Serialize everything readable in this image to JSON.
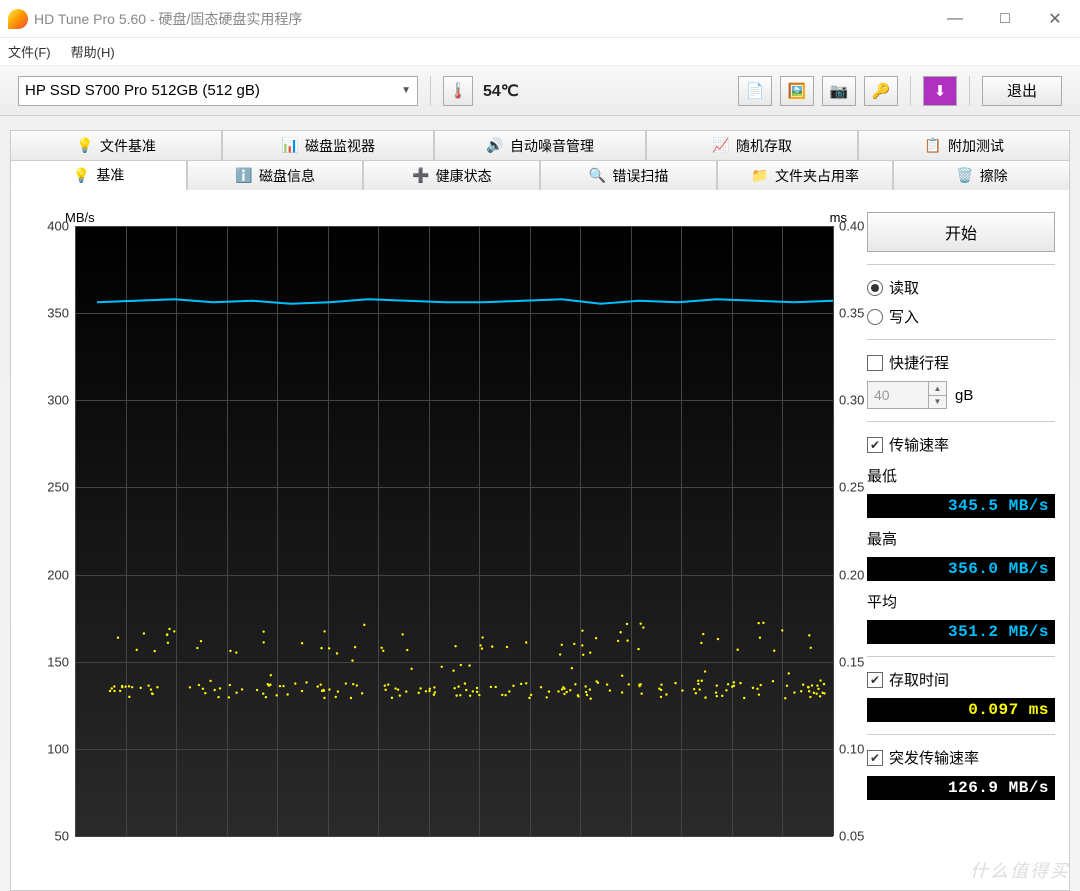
{
  "titlebar": {
    "title": "HD Tune Pro 5.60 - 硬盘/固态硬盘实用程序"
  },
  "menubar": {
    "file": "文件(F)",
    "help": "帮助(H)"
  },
  "toolbar": {
    "device": "HP SSD S700 Pro 512GB (512 gB)",
    "temperature": "54℃",
    "exit": "退出"
  },
  "tabs_top": [
    {
      "icon": "💡",
      "label": "文件基准"
    },
    {
      "icon": "📊",
      "label": "磁盘监视器"
    },
    {
      "icon": "🔊",
      "label": "自动噪音管理"
    },
    {
      "icon": "📈",
      "label": "随机存取"
    },
    {
      "icon": "📋",
      "label": "附加测试"
    }
  ],
  "tabs_bottom": [
    {
      "icon": "💡",
      "label": "基准",
      "active": true
    },
    {
      "icon": "ℹ️",
      "label": "磁盘信息"
    },
    {
      "icon": "➕",
      "label": "健康状态"
    },
    {
      "icon": "🔍",
      "label": "错误扫描"
    },
    {
      "icon": "📁",
      "label": "文件夹占用率"
    },
    {
      "icon": "🗑️",
      "label": "擦除"
    }
  ],
  "chart": {
    "left_unit": "MB/s",
    "right_unit": "ms",
    "left_ticks": [
      400,
      350,
      300,
      250,
      200,
      150,
      100,
      50
    ],
    "right_ticks": [
      "0.40",
      "0.35",
      "0.30",
      "0.25",
      "0.20",
      "0.15",
      "0.10",
      "0.05"
    ]
  },
  "side": {
    "start": "开始",
    "read": "读取",
    "write": "写入",
    "quick": "快捷行程",
    "quick_val": "40",
    "quick_unit": "gB",
    "transfer": "传输速率",
    "min_label": "最低",
    "min_value": "345.5 MB/s",
    "max_label": "最高",
    "max_value": "356.0 MB/s",
    "avg_label": "平均",
    "avg_value": "351.2 MB/s",
    "access_label": "存取时间",
    "access_value": "0.097 ms",
    "burst_label": "突发传输速率",
    "burst_value": "126.9 MB/s"
  },
  "chart_data": {
    "type": "line",
    "title": "",
    "xlabel": "",
    "y_left_label": "MB/s",
    "y_left_lim": [
      0,
      400
    ],
    "y_right_label": "ms",
    "y_right_lim": [
      0,
      0.4
    ],
    "series": [
      {
        "name": "Transfer Rate (MB/s)",
        "color": "#00bfff",
        "axis": "left",
        "values": [
          350,
          351,
          352,
          350,
          351,
          349,
          350,
          352,
          351,
          350,
          350,
          351,
          352,
          349,
          351,
          350,
          352,
          351,
          350,
          351
        ]
      },
      {
        "name": "Access Time (ms)",
        "color": "#ffff00",
        "axis": "right",
        "values": [
          0.095,
          0.097,
          0.095,
          0.12,
          0.097,
          0.098,
          0.095,
          0.13,
          0.097,
          0.096,
          0.095,
          0.095,
          0.097,
          0.095,
          0.11,
          0.096,
          0.095,
          0.097,
          0.096,
          0.095
        ]
      }
    ]
  },
  "watermark": "什么值得买"
}
